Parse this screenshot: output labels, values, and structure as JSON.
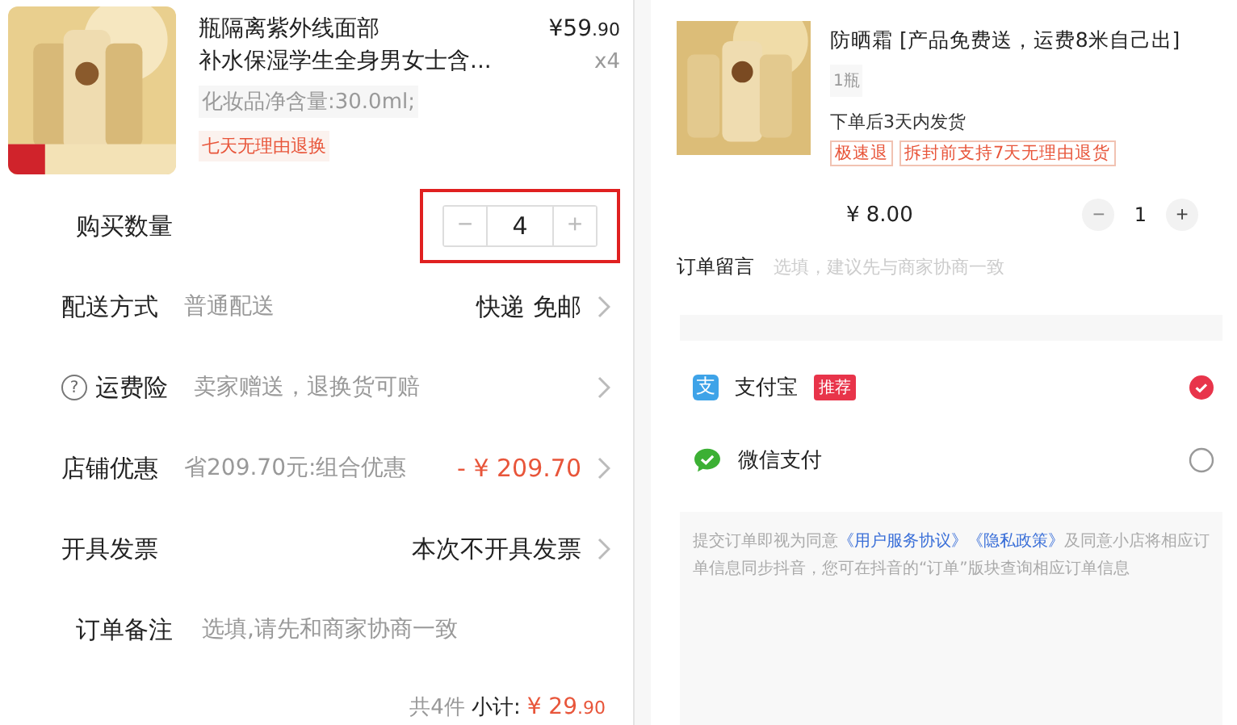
{
  "left": {
    "product": {
      "title_lines": [
        "瓶隔离紫外线面部",
        "补水保湿学生全身男女士含..."
      ],
      "price_main": "¥59",
      "price_decimal": ".90",
      "quantity": "x4",
      "spec": "化妆品净含量:30.0ml;",
      "tag": "七天无理由退换"
    },
    "rows": [
      {
        "kind": "stepper",
        "label": "购买数量",
        "minus": "−",
        "value": "4",
        "plus": "+",
        "highlighted": true
      },
      {
        "kind": "option",
        "label": "配送方式",
        "note": "普通配送",
        "value": "快递 免邮"
      },
      {
        "kind": "option",
        "label": "运费险",
        "help": "?",
        "note": "卖家赠送，退换货可赔"
      },
      {
        "kind": "discount",
        "label": "店铺优惠",
        "note": "省209.70元:组合优惠",
        "value": "- ¥ 209.70"
      },
      {
        "kind": "option",
        "label": "开具发票",
        "value": "本次不开具发票"
      },
      {
        "kind": "input",
        "label": "订单备注",
        "placeholder": "选填,请先和商家协商一致"
      }
    ],
    "summary": {
      "count": "共4件",
      "label": "小计:",
      "price_main": "¥ 29",
      "price_decimal": ".90"
    }
  },
  "right": {
    "product": {
      "title": "防晒霜 [产品免费送，运费8米自己出]",
      "spec": "1瓶",
      "shipping": "下单后3天内发货",
      "tags": [
        "极速退",
        "拆封前支持7天无理由退货"
      ],
      "price": "¥ 8.00",
      "minus": "−",
      "quantity": "1",
      "plus": "+"
    },
    "message": {
      "label": "订单留言",
      "placeholder": "选填，建议先与商家协商一致"
    },
    "payments": [
      {
        "kind": "alipay",
        "icon": "支",
        "name": "支付宝",
        "badge": "推荐",
        "selected": true
      },
      {
        "kind": "wechat",
        "name": "微信支付",
        "selected": false
      }
    ],
    "agreement": {
      "before": "提交订单即视为同意",
      "links": [
        "《用户服务协议》",
        "《隐私政策》"
      ],
      "after": "及同意小店将相应订单信息同步抖音，您可在抖音的“订单”版块查询相应订单信息"
    }
  }
}
